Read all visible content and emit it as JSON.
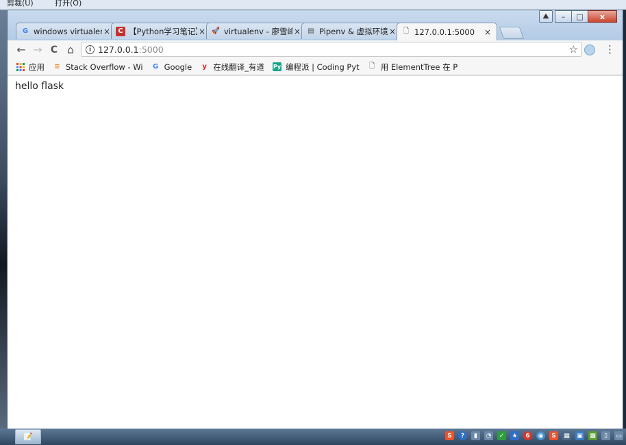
{
  "background_menu": {
    "items": [
      "剪裁(U)",
      "打开(O)"
    ]
  },
  "window": {
    "controls": {
      "minimize": "–",
      "maximize": "□",
      "close": "x"
    }
  },
  "tabs": [
    {
      "label": "windows virtualenv",
      "favicon": "google-icon",
      "fav_text": "G",
      "fav_color": "#4285f4",
      "close": "×"
    },
    {
      "label": "【Python学习笔记】",
      "favicon": "csdn-icon",
      "fav_text": "C",
      "fav_color": "#c9302c",
      "close": "×"
    },
    {
      "label": "virtualenv - 廖雪峰的",
      "favicon": "rocket-icon",
      "fav_text": "🚀",
      "fav_color": "#3d8fd6",
      "close": "×"
    },
    {
      "label": "Pipenv & 虚拟环境 -",
      "favicon": "book-icon",
      "fav_text": "▤",
      "fav_color": "#555555",
      "close": "×"
    },
    {
      "label": "127.0.0.1:5000",
      "favicon": "page-icon",
      "fav_text": "🗋",
      "fav_color": "#555555",
      "close": "×",
      "active": true
    }
  ],
  "toolbar": {
    "back": "←",
    "forward": "→",
    "reload": "C",
    "home": "⌂",
    "info": "i",
    "url_host": "127.0.0.1",
    "url_port": ":5000",
    "star": "☆",
    "menu": "⋮"
  },
  "bookmarks": [
    {
      "label": "应用",
      "icon": "apps-icon",
      "icon_text": "⋮⋮",
      "color": "#e0463b"
    },
    {
      "label": "Stack Overflow - Wi",
      "icon": "stackoverflow-icon",
      "icon_text": "≡",
      "color": "#f48024"
    },
    {
      "label": "Google",
      "icon": "google-icon",
      "icon_text": "G",
      "color": "#4285f4"
    },
    {
      "label": "在线翻译_有道",
      "icon": "youdao-icon",
      "icon_text": "y",
      "color": "#e02020"
    },
    {
      "label": "编程派 | Coding Pyt",
      "icon": "py-icon",
      "icon_text": "Py",
      "color": "#17a589"
    },
    {
      "label": "用 ElementTree 在 P",
      "icon": "page-icon",
      "icon_text": "🗋",
      "color": "#555555"
    }
  ],
  "content": {
    "text": "hello flask"
  },
  "taskbar": {
    "task_item": "📝",
    "tray_icons": [
      {
        "name": "sogou-icon",
        "text": "S",
        "color": "#e8542d"
      },
      {
        "name": "help-icon",
        "text": "?",
        "color": "#2f6ec7"
      },
      {
        "name": "usb-icon",
        "text": "▮",
        "color": "#6c8aa8"
      },
      {
        "name": "network-icon",
        "text": "◔",
        "color": "#6c8aa8"
      },
      {
        "name": "security-icon",
        "text": "✓",
        "color": "#2d9c3e"
      },
      {
        "name": "star-icon",
        "text": "★",
        "color": "#2f6ec7"
      },
      {
        "name": "weibo-icon",
        "text": "6",
        "color": "#d8352a"
      },
      {
        "name": "chat-icon",
        "text": "◉",
        "color": "#4a90c8"
      },
      {
        "name": "sogou2-icon",
        "text": "S",
        "color": "#e8542d"
      },
      {
        "name": "keyboard-icon",
        "text": "▦",
        "color": "#4d6a87"
      },
      {
        "name": "display-icon",
        "text": "▣",
        "color": "#3c7dc2"
      },
      {
        "name": "nvidia-icon",
        "text": "▩",
        "color": "#5a9e2f"
      },
      {
        "name": "power-icon",
        "text": "▯",
        "color": "#6c8aa8"
      },
      {
        "name": "monitor-icon",
        "text": "▭",
        "color": "#6c8aa8"
      }
    ]
  }
}
